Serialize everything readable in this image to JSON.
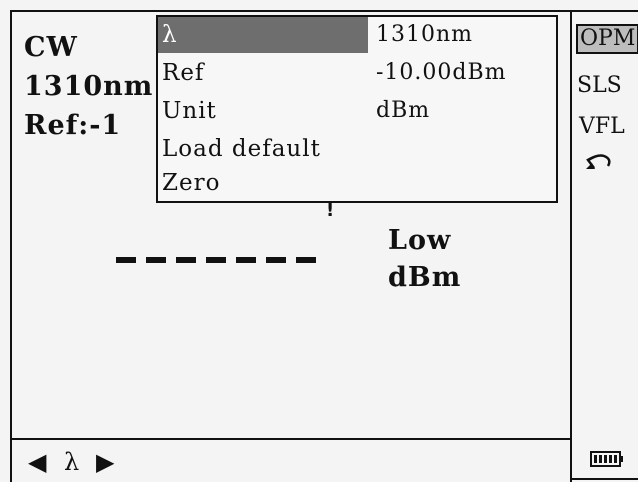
{
  "status": {
    "mode": "CW",
    "wavelength": "1310nm",
    "ref": "Ref:-1"
  },
  "menu": {
    "items": [
      {
        "label": "λ",
        "value": "1310nm",
        "selected": true
      },
      {
        "label": "Ref",
        "value": "-10.00dBm",
        "selected": false
      },
      {
        "label": "Unit",
        "value": "dBm",
        "selected": false
      },
      {
        "label": "Load default",
        "value": "",
        "selected": false
      },
      {
        "label": "Zero",
        "value": "",
        "selected": false
      }
    ]
  },
  "reading": {
    "power": "-------",
    "state": "Low",
    "unit": "dBm",
    "cursor": "!"
  },
  "sidebar": {
    "items": [
      {
        "label": "OPM",
        "selected": true
      },
      {
        "label": "SLS",
        "selected": false
      },
      {
        "label": "VFL",
        "selected": false
      }
    ],
    "back_icon": "undo-arrow-icon",
    "battery_icon": "battery-icon"
  },
  "bottom": {
    "left_arrow": "◀",
    "param": "λ",
    "right_arrow": "▶"
  }
}
